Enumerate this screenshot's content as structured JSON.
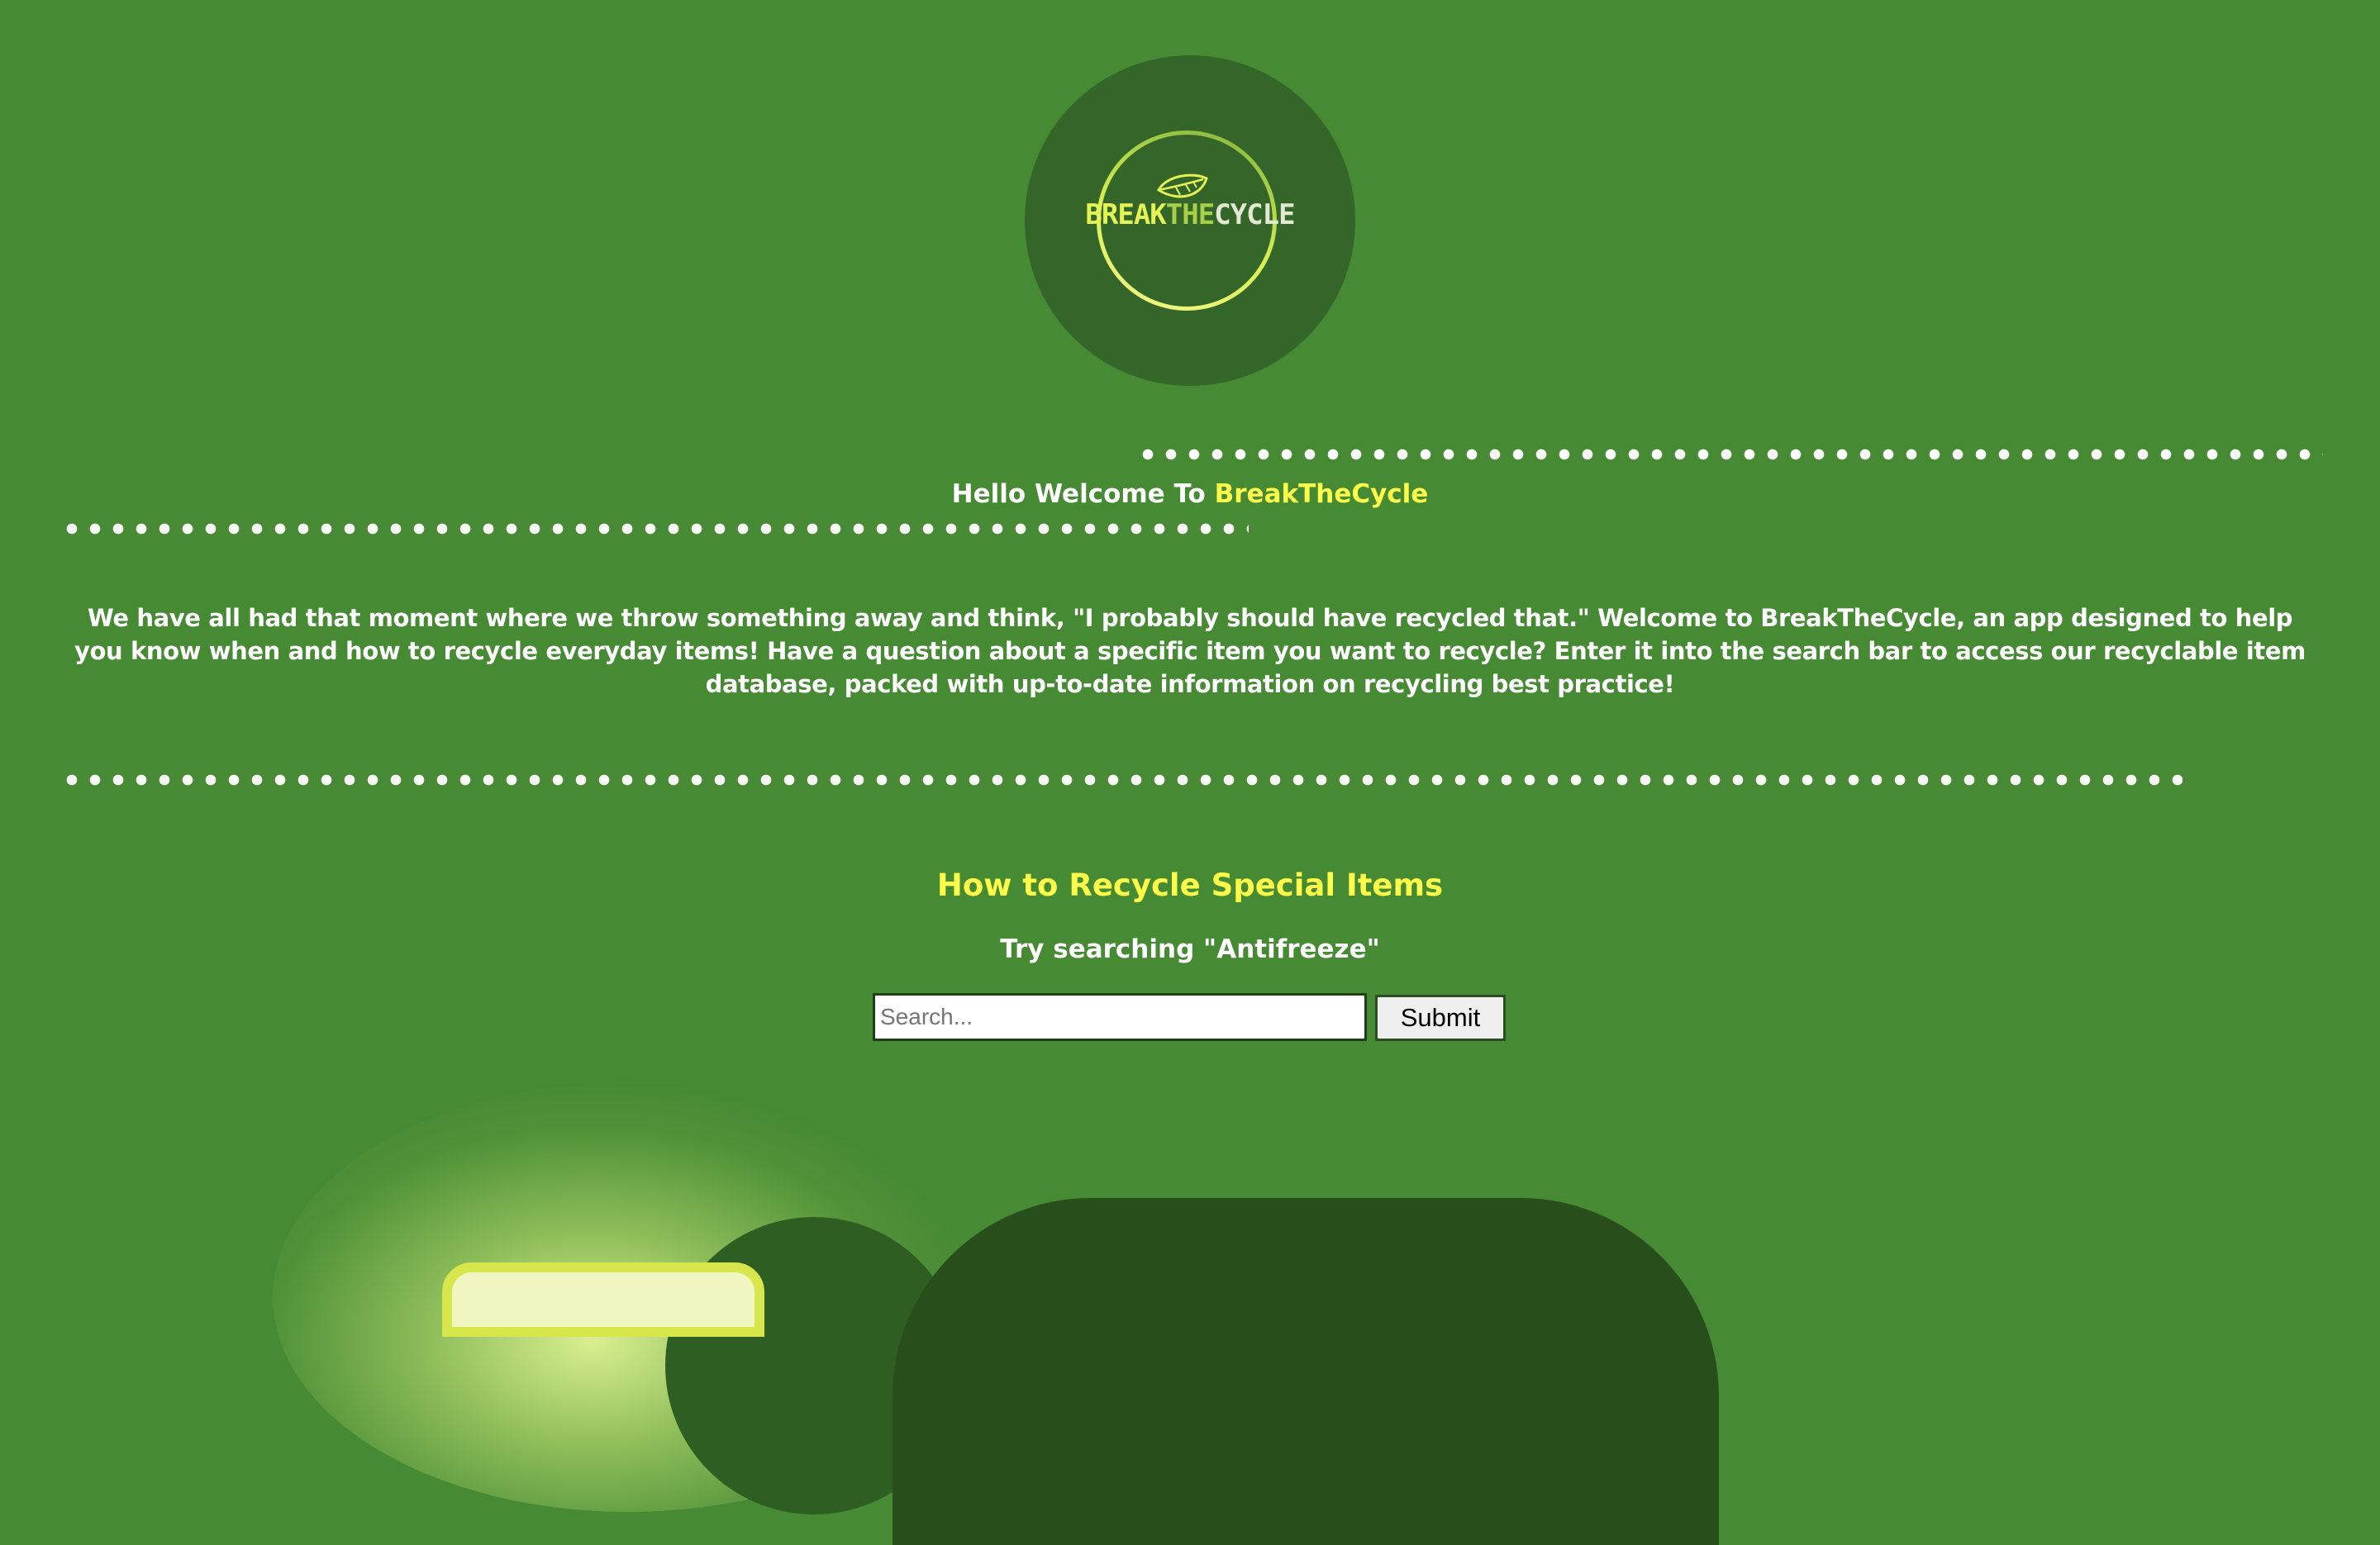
{
  "logo": {
    "text_part_1": "BREAK",
    "text_part_2": "THE",
    "text_part_3": "CYCLE",
    "icon": "leaf-icon"
  },
  "welcome": {
    "prefix": "Hello Welcome To",
    "brand": "BreakTheCycle"
  },
  "intro": {
    "text": "We have all had that moment where we throw something away and think, \"I probably should have recycled that.\" Welcome to BreakTheCycle, an app designed to help you know when and how to recycle everyday items! Have a question about a specific item you want to recycle? Enter it into the search bar to access our recyclable item database, packed with up-to-date information on recycling best practice!"
  },
  "special_items": {
    "title": "How to Recycle Special Items",
    "hint": "Try searching \"Antifreeze\""
  },
  "search": {
    "placeholder": "Search...",
    "value": "",
    "submit_label": "Submit"
  },
  "colors": {
    "background": "#468a34",
    "logo_circle": "#336628",
    "accent_yellow": "#ffff4a",
    "dark_panel": "#284e1c",
    "text": "#ffffff"
  }
}
